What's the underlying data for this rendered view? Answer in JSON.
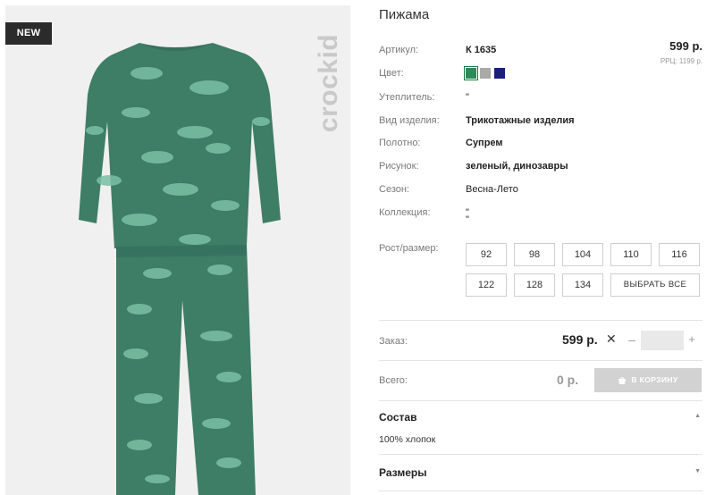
{
  "badge": {
    "label": "NEW"
  },
  "brand": {
    "name": "crockid"
  },
  "product": {
    "title": "Пижама",
    "price": "599 р.",
    "rrp": "РРЦ: 1199 р."
  },
  "specs": [
    {
      "label": "Артикул:",
      "value": "К 1635"
    },
    {
      "label": "Цвет:",
      "value": ""
    },
    {
      "label": "Утеплитель:",
      "value": "\""
    },
    {
      "label": "Вид изделия:",
      "value": "Трикотажные изделия"
    },
    {
      "label": "Полотно:",
      "value": "Супрем"
    },
    {
      "label": "Рисунок:",
      "value": "зеленый, динозавры"
    },
    {
      "label": "Сезон:",
      "value": "Весна-Лето"
    },
    {
      "label": "Коллекция:",
      "value": "\"",
      "value2": "\""
    }
  ],
  "colors": [
    "#2f8a57",
    "#a9a9a9",
    "#1b1f7a"
  ],
  "sizes": {
    "label": "Рост/размер:",
    "options": [
      "92",
      "98",
      "104",
      "110",
      "116",
      "122",
      "128",
      "134"
    ],
    "select_all": "ВЫБРАТЬ ВСЕ"
  },
  "order": {
    "label": "Заказ:",
    "price": "599 р.",
    "times": "✕",
    "minus": "–",
    "plus": "+",
    "qty": ""
  },
  "total": {
    "label": "Всего:",
    "value": "0 р.",
    "cart_label": "В КОРЗИНУ"
  },
  "accordion": [
    {
      "title": "Состав",
      "body": "100% хлопок",
      "expanded": true
    },
    {
      "title": "Размеры",
      "expanded": false
    }
  ],
  "accent_color": "#2f8a57"
}
